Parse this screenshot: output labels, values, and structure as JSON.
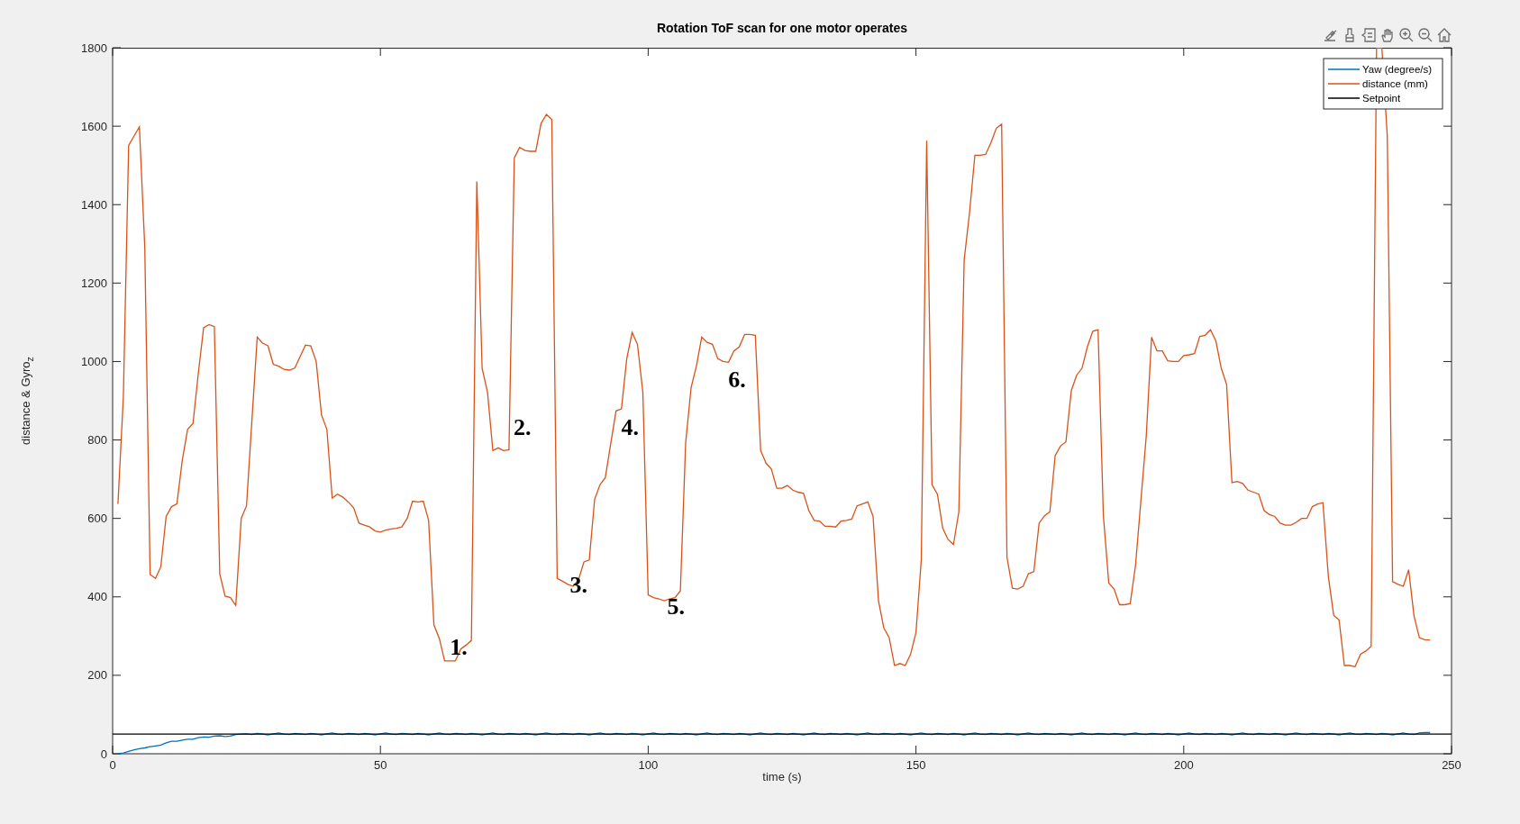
{
  "figure": {
    "chart_data": {
      "type": "line",
      "title": "Rotation ToF scan for one motor operates",
      "xlabel": "time (s)",
      "ylabel": "distance & Gyro$_{z}$",
      "x": [
        0,
        1,
        2,
        3,
        4,
        5,
        6,
        7,
        8,
        9,
        10,
        11,
        12,
        13,
        14,
        15,
        16,
        17,
        18,
        19,
        20,
        21,
        22,
        23,
        24,
        25,
        26,
        27,
        28,
        29,
        30,
        31,
        32,
        33,
        34,
        35,
        36,
        37,
        38,
        39,
        40,
        41,
        42,
        43,
        44,
        45,
        46,
        47,
        48,
        49,
        50,
        51,
        52,
        53,
        54,
        55,
        56,
        57,
        58,
        59,
        60,
        61,
        62,
        63,
        64,
        65,
        66,
        67,
        68,
        69,
        70,
        71,
        72,
        73,
        74,
        75,
        76,
        77,
        78,
        79,
        80,
        81,
        82,
        83,
        84,
        85,
        86,
        87,
        88,
        89,
        90,
        91,
        92,
        93,
        94,
        95,
        96,
        97,
        98,
        99,
        100,
        101,
        102,
        103,
        104,
        105,
        106,
        107,
        108,
        109,
        110,
        111,
        112,
        113,
        114,
        115,
        116,
        117,
        118,
        119,
        120,
        121,
        122,
        123,
        124,
        125,
        126,
        127,
        128,
        129,
        130,
        131,
        132,
        133,
        134,
        135,
        136,
        137,
        138,
        139,
        140,
        141,
        142,
        143,
        144,
        145,
        146,
        147,
        148,
        149,
        150,
        151,
        152,
        153,
        154,
        155,
        156,
        157,
        158,
        159,
        160,
        161,
        162,
        163,
        164,
        165,
        166,
        167,
        168,
        169,
        170,
        171,
        172,
        173,
        174,
        175,
        176,
        177,
        178,
        179,
        180,
        181,
        182,
        183,
        184,
        185,
        186,
        187,
        188,
        189,
        190,
        191,
        192,
        193,
        194,
        195,
        196,
        197,
        198,
        199,
        200,
        201,
        202,
        203,
        204,
        205,
        206,
        207,
        208,
        209,
        210,
        211,
        212,
        213,
        214,
        215,
        216,
        217,
        218,
        219,
        220,
        221,
        222,
        223,
        224,
        225,
        226,
        227,
        228,
        229,
        230,
        231,
        232,
        233,
        234,
        235,
        236,
        237,
        238,
        239,
        240,
        241,
        242,
        243,
        244,
        245,
        246,
        250
      ],
      "series": [
        {
          "name": "Yaw (degree/s)",
          "color": "#0072bd",
          "values": [
            null,
            0,
            2,
            6,
            10,
            13,
            15,
            18,
            20,
            22,
            28,
            32,
            32,
            35,
            37,
            37,
            41,
            43,
            42,
            45,
            46,
            44,
            45,
            49,
            50,
            51,
            49,
            52,
            50,
            48,
            51,
            53,
            50,
            49,
            52,
            51,
            49,
            52,
            50,
            48,
            51,
            53,
            50,
            49,
            52,
            51,
            49,
            52,
            50,
            48,
            51,
            53,
            50,
            49,
            52,
            51,
            49,
            52,
            50,
            48,
            51,
            53,
            50,
            49,
            52,
            51,
            49,
            52,
            50,
            48,
            51,
            53,
            50,
            49,
            52,
            51,
            49,
            52,
            50,
            48,
            51,
            53,
            50,
            49,
            52,
            51,
            49,
            52,
            50,
            48,
            51,
            53,
            50,
            49,
            52,
            51,
            49,
            52,
            50,
            48,
            51,
            53,
            50,
            49,
            52,
            51,
            49,
            52,
            50,
            48,
            51,
            53,
            50,
            49,
            52,
            51,
            49,
            52,
            50,
            48,
            51,
            53,
            50,
            49,
            52,
            51,
            49,
            52,
            50,
            48,
            51,
            53,
            50,
            49,
            52,
            51,
            49,
            52,
            50,
            48,
            51,
            53,
            50,
            49,
            52,
            51,
            49,
            52,
            50,
            48,
            51,
            53,
            50,
            49,
            52,
            51,
            49,
            52,
            50,
            48,
            51,
            53,
            50,
            49,
            52,
            51,
            49,
            52,
            50,
            48,
            51,
            53,
            50,
            49,
            52,
            51,
            49,
            52,
            50,
            48,
            51,
            53,
            50,
            49,
            52,
            51,
            49,
            52,
            50,
            48,
            51,
            53,
            50,
            49,
            52,
            51,
            49,
            52,
            50,
            48,
            51,
            53,
            50,
            49,
            52,
            51,
            49,
            52,
            50,
            48,
            51,
            53,
            50,
            49,
            52,
            51,
            49,
            52,
            50,
            48,
            51,
            53,
            50,
            49,
            52,
            51,
            49,
            52,
            50,
            48,
            51,
            53,
            50,
            49,
            52,
            51,
            49,
            52,
            50,
            48,
            51,
            53,
            50,
            49,
            53,
            54,
            54,
            null
          ]
        },
        {
          "name": "distance (mm)",
          "color": "#d95319",
          "values": [
            null,
            637,
            909,
            1551,
            1575,
            1598,
            1291,
            457,
            447,
            477,
            605,
            630,
            637,
            748,
            827,
            842,
            970,
            1086,
            1094,
            1089,
            459,
            402,
            398,
            378,
            600,
            632,
            847,
            1062,
            1047,
            1040,
            993,
            988,
            980,
            978,
            983,
            1012,
            1042,
            1040,
            1000,
            864,
            827,
            652,
            662,
            654,
            642,
            627,
            588,
            583,
            578,
            568,
            565,
            570,
            573,
            575,
            578,
            600,
            644,
            642,
            644,
            595,
            328,
            294,
            237,
            237,
            237,
            267,
            277,
            289,
            1459,
            983,
            921,
            773,
            780,
            773,
            775,
            1519,
            1546,
            1538,
            1536,
            1536,
            1607,
            1630,
            1617,
            447,
            440,
            432,
            427,
            444,
            489,
            494,
            649,
            686,
            704,
            790,
            874,
            879,
            1007,
            1074,
            1044,
            921,
            405,
            398,
            395,
            390,
            395,
            398,
            415,
            793,
            933,
            988,
            1062,
            1049,
            1044,
            1007,
            1000,
            998,
            1027,
            1037,
            1069,
            1069,
            1067,
            773,
            741,
            726,
            677,
            677,
            684,
            672,
            667,
            664,
            620,
            595,
            593,
            580,
            580,
            578,
            593,
            595,
            598,
            632,
            637,
            642,
            605,
            390,
            321,
            296,
            225,
            230,
            225,
            254,
            309,
            494,
            1563,
            686,
            662,
            575,
            546,
            533,
            617,
            1259,
            1378,
            1526,
            1526,
            1528,
            1558,
            1595,
            1605,
            501,
            422,
            420,
            427,
            459,
            464,
            588,
            607,
            617,
            760,
            785,
            795,
            926,
            965,
            983,
            1037,
            1077,
            1081,
            607,
            435,
            420,
            380,
            380,
            383,
            481,
            644,
            810,
            1062,
            1027,
            1027,
            1002,
            1000,
            1000,
            1015,
            1017,
            1020,
            1064,
            1067,
            1081,
            1052,
            983,
            941,
            691,
            694,
            689,
            672,
            667,
            662,
            620,
            610,
            605,
            588,
            583,
            583,
            590,
            600,
            600,
            630,
            637,
            640,
            452,
            353,
            341,
            225,
            225,
            222,
            254,
            262,
            274,
            1800,
            1800,
            1575,
            439,
            432,
            427,
            469,
            351,
            296,
            291,
            290,
            null
          ]
        },
        {
          "name": "Setpoint",
          "color": "#000000",
          "values": [
            50,
            50,
            50,
            50,
            50,
            50,
            50,
            50,
            50,
            50,
            50,
            50,
            50,
            50,
            50,
            50,
            50,
            50,
            50,
            50,
            50,
            50,
            50,
            50,
            50,
            50,
            50,
            50,
            50,
            50,
            50,
            50,
            50,
            50,
            50,
            50,
            50,
            50,
            50,
            50,
            50,
            50,
            50,
            50,
            50,
            50,
            50,
            50,
            50,
            50,
            50,
            50,
            50,
            50,
            50,
            50,
            50,
            50,
            50,
            50,
            50,
            50,
            50,
            50,
            50,
            50,
            50,
            50,
            50,
            50,
            50,
            50,
            50,
            50,
            50,
            50,
            50,
            50,
            50,
            50,
            50,
            50,
            50,
            50,
            50,
            50,
            50,
            50,
            50,
            50,
            50,
            50,
            50,
            50,
            50,
            50,
            50,
            50,
            50,
            50,
            50,
            50,
            50,
            50,
            50,
            50,
            50,
            50,
            50,
            50,
            50,
            50,
            50,
            50,
            50,
            50,
            50,
            50,
            50,
            50,
            50,
            50,
            50,
            50,
            50,
            50,
            50,
            50,
            50,
            50,
            50,
            50,
            50,
            50,
            50,
            50,
            50,
            50,
            50,
            50,
            50,
            50,
            50,
            50,
            50,
            50,
            50,
            50,
            50,
            50,
            50,
            50,
            50,
            50,
            50,
            50,
            50,
            50,
            50,
            50,
            50,
            50,
            50,
            50,
            50,
            50,
            50,
            50,
            50,
            50,
            50,
            50,
            50,
            50,
            50,
            50,
            50,
            50,
            50,
            50,
            50,
            50,
            50,
            50,
            50,
            50,
            50,
            50,
            50,
            50,
            50,
            50,
            50,
            50,
            50,
            50,
            50,
            50,
            50,
            50,
            50,
            50,
            50,
            50,
            50,
            50,
            50,
            50,
            50,
            50,
            50,
            50,
            50,
            50,
            50,
            50,
            50,
            50,
            50,
            50,
            50,
            50,
            50,
            50,
            50,
            50,
            50,
            50,
            50,
            50,
            50,
            50,
            50,
            50,
            50,
            50,
            50,
            50,
            50,
            50,
            50,
            50,
            50,
            50,
            50,
            50,
            50,
            50
          ]
        }
      ],
      "xlim": [
        0,
        250
      ],
      "ylim": [
        0,
        1800
      ],
      "xticks": [
        0,
        50,
        100,
        150,
        200,
        250
      ],
      "yticks": [
        0,
        200,
        400,
        600,
        800,
        1000,
        1200,
        1400,
        1600,
        1800
      ],
      "legend": "upper right",
      "annotations": [
        "1.",
        "2.",
        "3.",
        "4.",
        "5.",
        "6."
      ]
    }
  }
}
